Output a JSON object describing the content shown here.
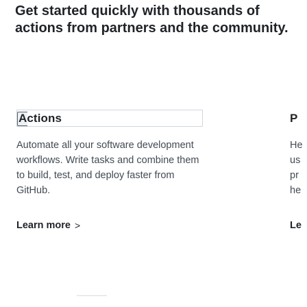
{
  "intro": {
    "heading": "Get started quickly with thousands of actions from partners and the community."
  },
  "card_actions": {
    "title": "Actions",
    "description": "Automate all your software development workflows. Write tasks and combine them to build, test, and deploy faster from GitHub.",
    "link_label": "Learn more",
    "link_chevron": ">"
  },
  "card_right_partial": {
    "title": "P",
    "desc_lines": [
      "He",
      "us",
      "pr",
      "he"
    ],
    "link_label": "Le"
  },
  "icons": {
    "title_icon": "actions-icon",
    "link_icon": "chevron-right-icon"
  }
}
